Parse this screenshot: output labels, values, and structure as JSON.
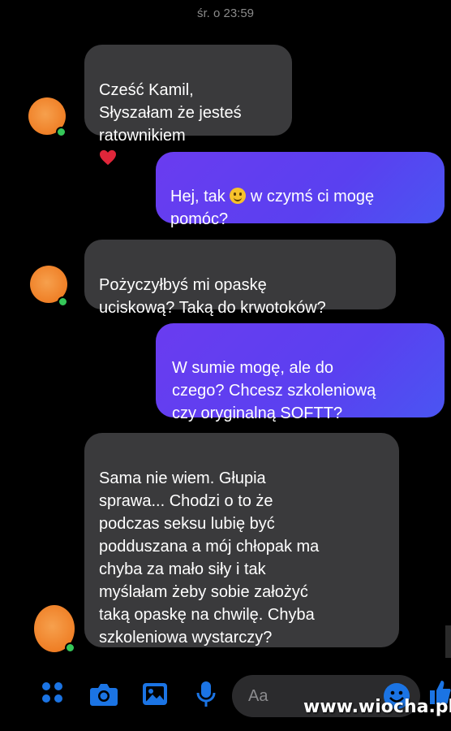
{
  "header": {
    "timestamp": "śr. o 23:59"
  },
  "messages": [
    {
      "from": "them",
      "text": "Cześć Kamil,\nSłyszałam że jesteś\nratownikiem",
      "emoji": "heart"
    },
    {
      "from": "me",
      "text_a": "Hej, tak ",
      "emoji": "smile",
      "text_b": " w czymś ci mogę\npomóc?"
    },
    {
      "from": "them",
      "text": "Pożyczyłbyś mi opaskę\nuciskową? Taką do krwotoków?"
    },
    {
      "from": "me",
      "text": "W sumie mogę, ale do\nczego? Chcesz szkoleniową\nczy oryginalną SOFTT?"
    },
    {
      "from": "them",
      "text": "Sama nie wiem. Głupia\nsprawa... Chodzi o to że\npodczas seksu lubię być\npodduszana a mój chłopak ma\nchyba za mało siły i tak\nmyślałam żeby sobie założyć\ntaką opaskę na chwilę. Chyba\nszkoleniowa wystarczy?"
    }
  ],
  "composer": {
    "placeholder": "Aa",
    "icons": [
      "apps-icon",
      "camera-icon",
      "gallery-icon",
      "microphone-icon",
      "emoji-icon",
      "like-icon"
    ]
  },
  "watermark": "www.wiocha.pl",
  "colors": {
    "incoming": "#3a3a3c",
    "outgoing": "#5a40f0",
    "accent": "#1b74e4",
    "avatar": "#ef7f26"
  }
}
